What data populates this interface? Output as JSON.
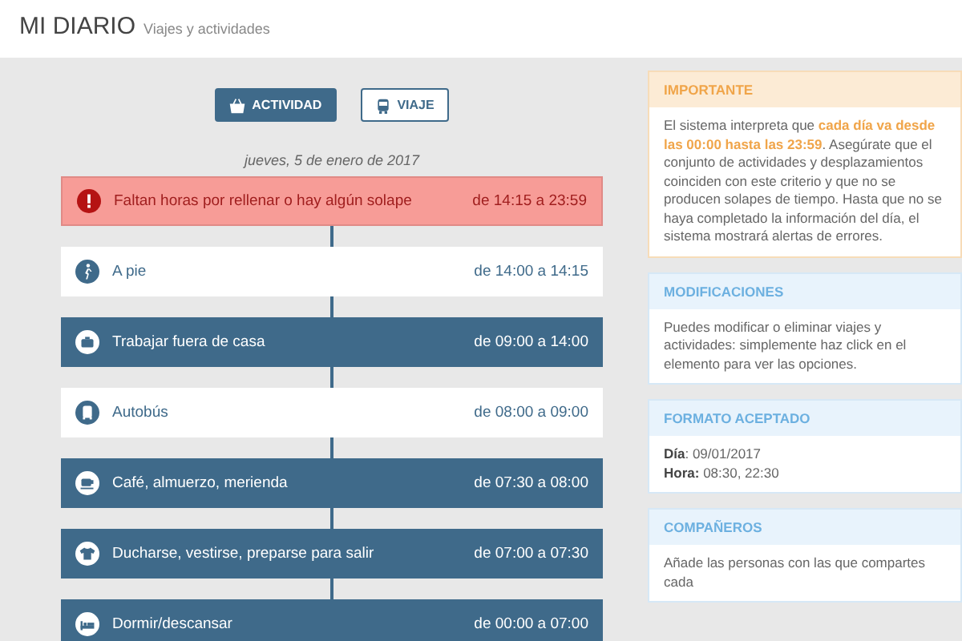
{
  "header": {
    "title": "MI DIARIO",
    "subtitle": "Viajes y actividades"
  },
  "actions": [
    {
      "label": "ACTIVIDAD",
      "kind": "activity"
    },
    {
      "label": "VIAJE",
      "kind": "travel"
    }
  ],
  "date": "jueves, 5 de enero de 2017",
  "timeline": [
    {
      "kind": "alert",
      "label": "Faltan horas por rellenar o hay algún solape",
      "time": "de 14:15 a 23:59"
    },
    {
      "kind": "travel",
      "label": "A pie",
      "time": "de 14:00 a 14:15"
    },
    {
      "kind": "activity",
      "label": "Trabajar fuera de casa",
      "time": "de 09:00 a 14:00"
    },
    {
      "kind": "travel",
      "label": "Autobús",
      "time": "de 08:00 a 09:00"
    },
    {
      "kind": "activity",
      "label": "Café, almuerzo, merienda",
      "time": "de 07:30 a 08:00"
    },
    {
      "kind": "activity",
      "label": "Ducharse, vestirse, preparse para salir",
      "time": "de 07:00 a 07:30"
    },
    {
      "kind": "activity",
      "label": "Dormir/descansar",
      "time": "de 00:00 a 07:00"
    }
  ],
  "panels": [
    {
      "kind": "warning",
      "title": "IMPORTANTE",
      "text": "El sistema interpreta que **cada día va desde las 00:00 hasta las 23:59**. Asegúrate que el conjunto de actividades y desplazamientos coinciden con este criterio y que no se producen solapes de tiempo. Hasta que no se haya completado la información del día, el sistema mostrará alertas de errores."
    },
    {
      "kind": "info",
      "title": "MODIFICACIONES",
      "text": "Puedes modificar o eliminar viajes y actividades: simplemente haz click en el elemento para ver las opciones."
    },
    {
      "kind": "info",
      "title": "FORMATO ACEPTADO",
      "lines": [
        "**Día**: 09/01/2017",
        "**Hora:** 08:30, 22:30"
      ]
    },
    {
      "kind": "info",
      "title": "COMPAÑEROS",
      "text": "Añade las personas con las que compartes cada"
    }
  ]
}
